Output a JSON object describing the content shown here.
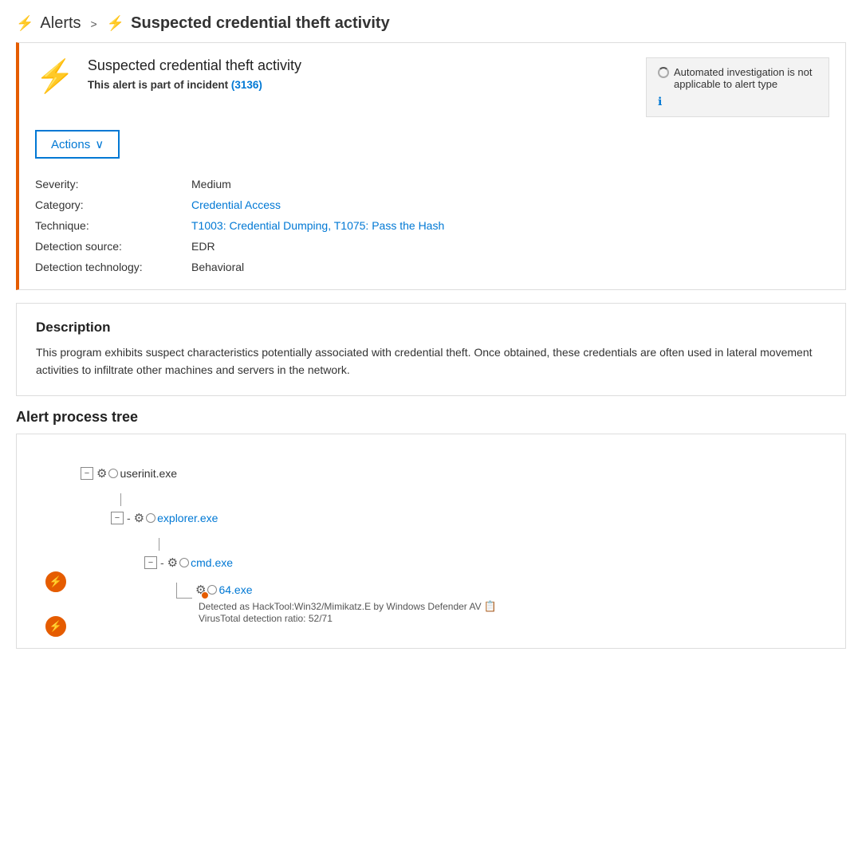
{
  "header": {
    "breadcrumb_label": "Alerts",
    "breadcrumb_sep": ">",
    "bolt_icon": "⚡",
    "title": "Suspected credential theft activity"
  },
  "alert_card": {
    "icon": "⚡",
    "title": "Suspected credential theft activity",
    "incident_text": "This alert is part of incident",
    "incident_link_text": "(3136)",
    "incident_link_href": "#",
    "actions_btn_label": "Actions",
    "actions_chevron": "∨",
    "auto_invest": {
      "text": "Automated investigation is not applicable to alert type",
      "info_icon": "ℹ"
    },
    "details": {
      "severity_label": "Severity:",
      "severity_value": "Medium",
      "category_label": "Category:",
      "category_value": "Credential Access",
      "category_href": "#",
      "technique_label": "Technique:",
      "technique_value": "T1003: Credential Dumping, T1075: Pass the Hash",
      "technique_href": "#",
      "detection_source_label": "Detection source:",
      "detection_source_value": "EDR",
      "detection_tech_label": "Detection technology:",
      "detection_tech_value": "Behavioral"
    }
  },
  "description_card": {
    "title": "Description",
    "text": "This program exhibits suspect characteristics potentially associated with credential theft. Once obtained, these credentials are often used in lateral movement activities to infiltrate other machines and servers in the network."
  },
  "process_tree": {
    "section_title": "Alert process tree",
    "nodes": [
      {
        "id": "userinit",
        "name": "userinit.exe",
        "indent": 0,
        "is_link": false,
        "has_collapse": true,
        "collapse_symbol": "−"
      },
      {
        "id": "explorer",
        "name": "explorer.exe",
        "indent": 1,
        "is_link": true,
        "has_collapse": true,
        "collapse_symbol": "−"
      },
      {
        "id": "cmd",
        "name": "cmd.exe",
        "indent": 2,
        "is_link": true,
        "has_collapse": true,
        "collapse_symbol": "−"
      },
      {
        "id": "64exe",
        "name": "64.exe",
        "indent": 3,
        "is_link": true,
        "has_collapse": false,
        "detected_text": "Detected as HackTool:Win32/Mimikatz.E by Windows Defender AV",
        "virus_text": "VirusTotal detection ratio: 52/71"
      }
    ]
  }
}
